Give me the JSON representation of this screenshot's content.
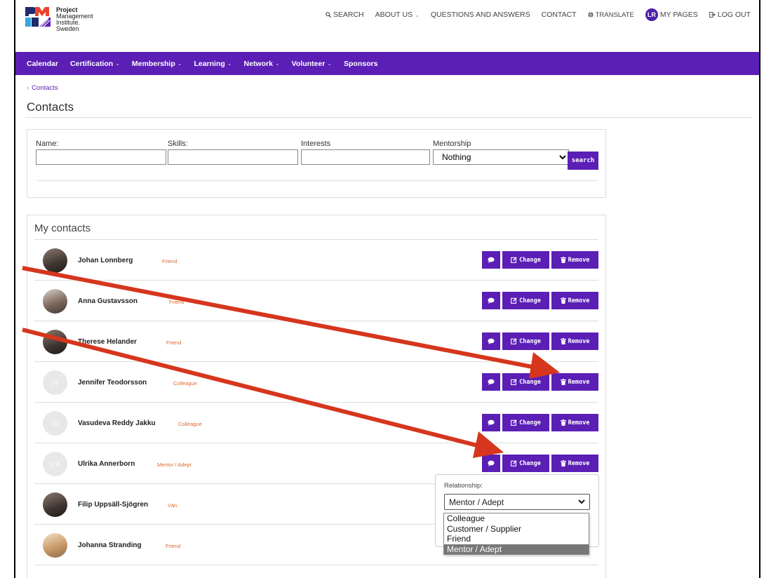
{
  "header": {
    "logo_lines": [
      "Project",
      "Management",
      "Institute.",
      "Sweden"
    ],
    "top_links": {
      "search": "SEARCH",
      "about": "ABOUT US",
      "qa": "QUESTIONS AND ANSWERS",
      "contact": "CONTACT",
      "translate": "TRANSLATE",
      "avatar_initials": "LR",
      "my_pages": "MY PAGES",
      "logout": "LOG OUT"
    }
  },
  "main_nav": [
    "Calendar",
    "Certification",
    "Membership",
    "Learning",
    "Network",
    "Volunteer",
    "Sponsors"
  ],
  "breadcrumb": "Contacts",
  "page_title": "Contacts",
  "search": {
    "name_label": "Name:",
    "skills_label": "Skills:",
    "interests_label": "Interests",
    "mentorship_label": "Mentorship",
    "mentorship_value": "Nothing",
    "button": "search"
  },
  "contacts": {
    "heading": "My contacts",
    "change_label": "Change",
    "remove_label": "Remove",
    "rows": [
      {
        "name": "Johan Lonnberg",
        "relation": "Friend",
        "initials": ""
      },
      {
        "name": "Anna Gustavsson",
        "relation": "Friend",
        "initials": ""
      },
      {
        "name": "Therese Helander",
        "relation": "Friend",
        "initials": ""
      },
      {
        "name": "Jennifer Teodorsson",
        "relation": "Colleague",
        "initials": "JT"
      },
      {
        "name": "Vasudeva Reddy Jakku",
        "relation": "Colleague",
        "initials": "VJ"
      },
      {
        "name": "Ulrika Annerborn",
        "relation": "Mentor / Adept",
        "initials": "U.A"
      },
      {
        "name": "Filip Uppsäll-Sjögren",
        "relation": "Vän",
        "initials": ""
      },
      {
        "name": "Johanna Stranding",
        "relation": "Friend",
        "initials": ""
      }
    ]
  },
  "relationship_popup": {
    "label": "Relationship:",
    "selected": "Mentor / Adept",
    "options": [
      "Colleague",
      "Customer / Supplier",
      "Friend",
      "Mentor / Adept"
    ]
  },
  "colors": {
    "brand": "#5b1fb5",
    "relation_tag": "#e06a2b",
    "annotation_arrow": "#d6361d"
  }
}
